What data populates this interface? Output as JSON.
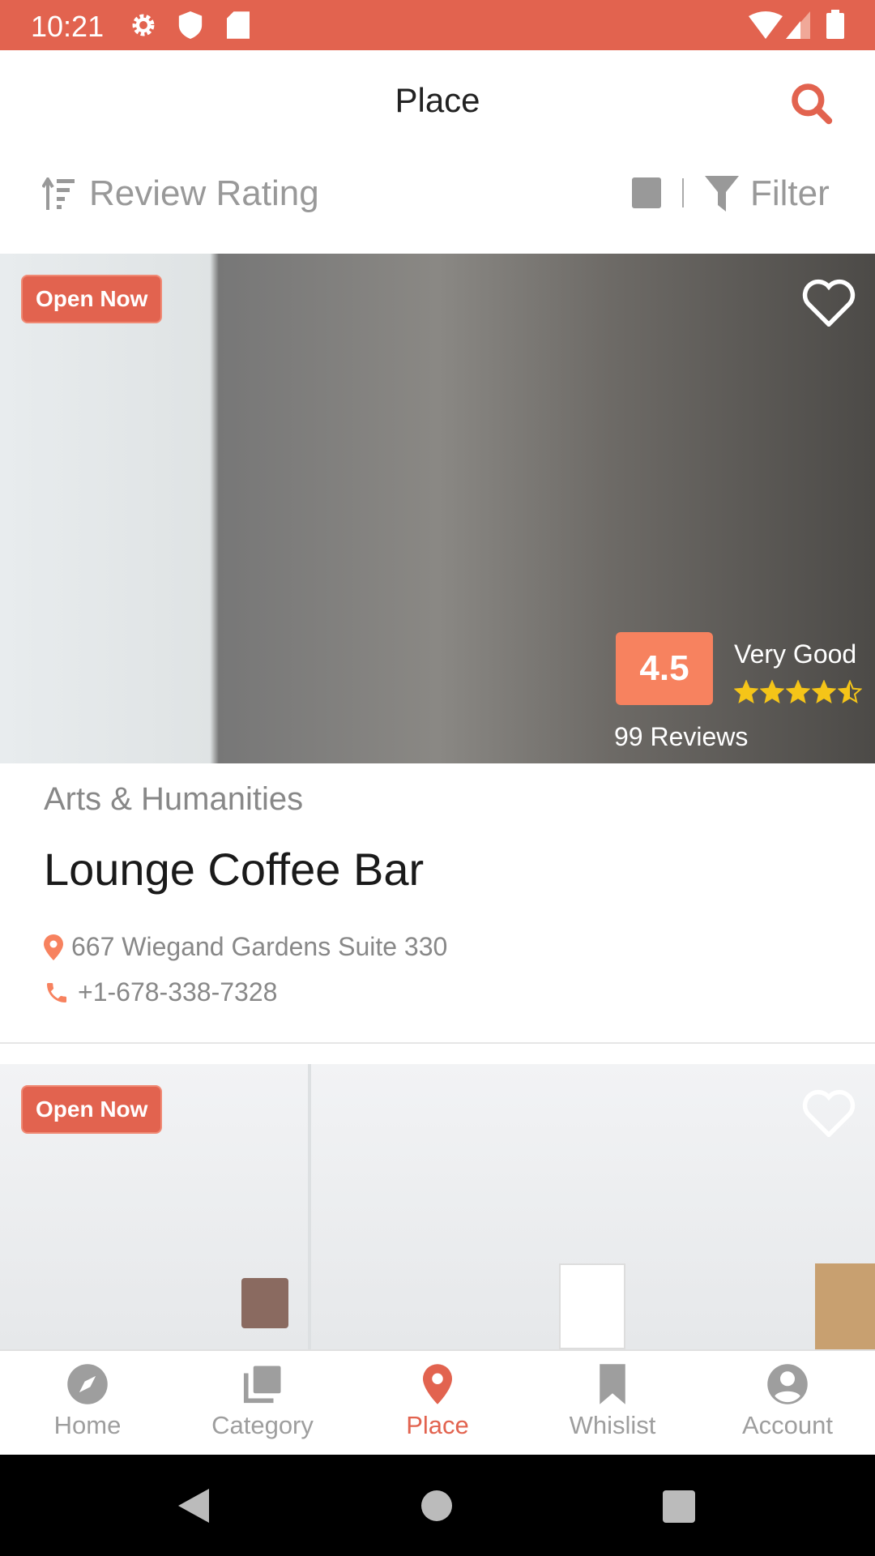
{
  "status_bar": {
    "time": "10:21"
  },
  "app_bar": {
    "title": "Place",
    "search_icon": "search-icon"
  },
  "sort_bar": {
    "sort_label": "Review Rating",
    "filter_label": "Filter"
  },
  "colors": {
    "accent": "#e2634f",
    "rating": "#f7825f",
    "star": "#f5c518"
  },
  "places": [
    {
      "badge": "Open Now",
      "rating": "4.5",
      "rating_text": "Very Good",
      "stars": 4.5,
      "reviews": "99 Reviews",
      "category": "Arts & Humanities",
      "name": "Lounge Coffee Bar",
      "address": "667 Wiegand Gardens Suite 330",
      "phone": "+1-678-338-7328"
    },
    {
      "badge": "Open Now"
    }
  ],
  "bottom_nav": [
    {
      "label": "Home"
    },
    {
      "label": "Category"
    },
    {
      "label": "Place",
      "active": true
    },
    {
      "label": "Whislist"
    },
    {
      "label": "Account"
    }
  ]
}
